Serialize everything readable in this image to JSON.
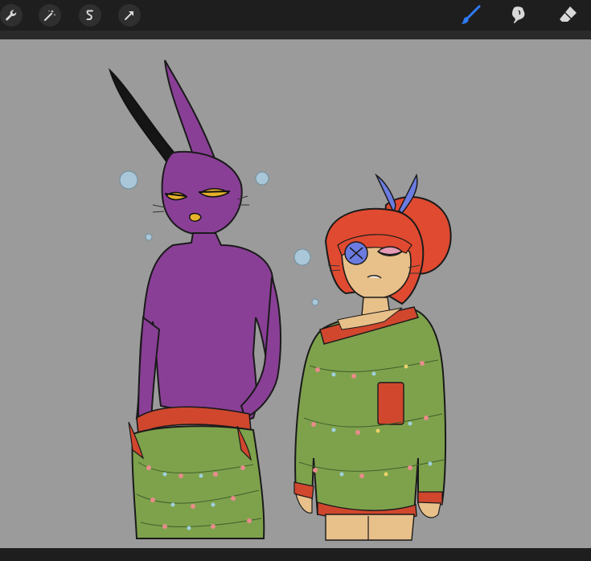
{
  "colors": {
    "toolbar": "#1e1e1e",
    "canvas": "#9b9b9b",
    "accent": "#2f7bf5",
    "icon": "#d8d8d8"
  },
  "toolbar": {
    "left_tools": [
      {
        "icon": "wrench-icon",
        "name": "actions"
      },
      {
        "icon": "magic-wand-icon",
        "name": "adjustments"
      },
      {
        "icon": "selection-icon",
        "name": "selection"
      },
      {
        "icon": "arrow-cursor-icon",
        "name": "transform"
      }
    ],
    "right_tools": [
      {
        "icon": "brush-icon",
        "name": "paint",
        "active": true
      },
      {
        "icon": "smudge-icon",
        "name": "smudge",
        "active": false
      },
      {
        "icon": "eraser-icon",
        "name": "erase",
        "active": false
      }
    ]
  }
}
